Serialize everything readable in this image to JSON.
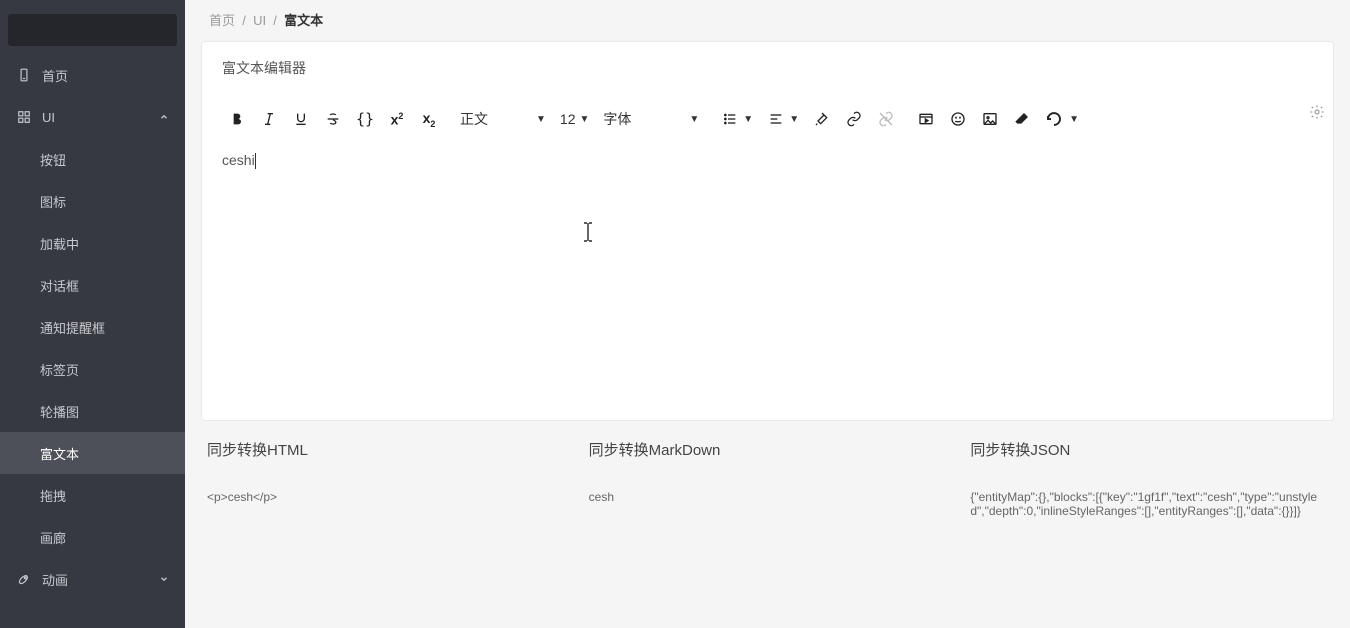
{
  "sidebar": {
    "items": [
      {
        "label": "首页",
        "icon": "file"
      },
      {
        "label": "UI",
        "icon": "ui",
        "expanded": true,
        "children": [
          {
            "label": "按钮"
          },
          {
            "label": "图标"
          },
          {
            "label": "加载中"
          },
          {
            "label": "对话框"
          },
          {
            "label": "通知提醒框"
          },
          {
            "label": "标签页"
          },
          {
            "label": "轮播图"
          },
          {
            "label": "富文本",
            "active": true
          },
          {
            "label": "拖拽"
          },
          {
            "label": "画廊"
          }
        ]
      },
      {
        "label": "动画",
        "icon": "rocket",
        "expanded": false
      }
    ]
  },
  "breadcrumb": {
    "a": "首页",
    "b": "UI",
    "c": "富文本"
  },
  "card": {
    "title": "富文本编辑器"
  },
  "toolbar": {
    "block_format": "正文",
    "font_size": "12",
    "font_family": "字体"
  },
  "editor": {
    "content": "ceshi"
  },
  "outputs": {
    "html": {
      "title": "同步转换HTML",
      "body": "<p>cesh</p>"
    },
    "md": {
      "title": "同步转换MarkDown",
      "body": "cesh"
    },
    "json": {
      "title": "同步转换JSON",
      "body": "{\"entityMap\":{},\"blocks\":[{\"key\":\"1gf1f\",\"text\":\"cesh\",\"type\":\"unstyled\",\"depth\":0,\"inlineStyleRanges\":[],\"entityRanges\":[],\"data\":{}}]}"
    }
  }
}
